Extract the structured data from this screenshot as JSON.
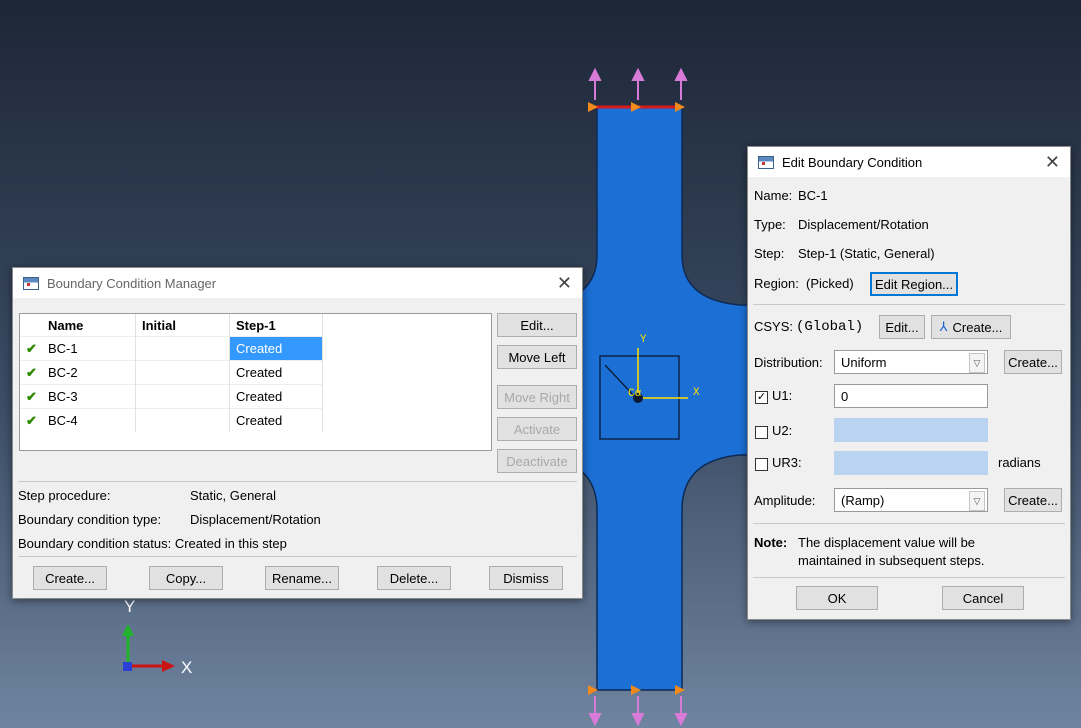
{
  "viewport": {
    "triad": {
      "y_label": "Y",
      "x_label": "X"
    },
    "csys": {
      "y_label": "Y",
      "x_label": "X"
    }
  },
  "manager": {
    "title": "Boundary Condition Manager",
    "columns": [
      "Name",
      "Initial",
      "Step-1"
    ],
    "rows": [
      {
        "name": "BC-1",
        "initial": "",
        "step1": "Created",
        "selected": true
      },
      {
        "name": "BC-2",
        "initial": "",
        "step1": "Created",
        "selected": false
      },
      {
        "name": "BC-3",
        "initial": "",
        "step1": "Created",
        "selected": false
      },
      {
        "name": "BC-4",
        "initial": "",
        "step1": "Created",
        "selected": false
      }
    ],
    "side_buttons": {
      "edit": "Edit...",
      "move_left": "Move Left",
      "move_right": "Move Right",
      "activate": "Activate",
      "deactivate": "Deactivate"
    },
    "info": {
      "procedure_label": "Step procedure:",
      "procedure_value": "Static, General",
      "type_label": "Boundary condition type:",
      "type_value": "Displacement/Rotation",
      "status_label": "Boundary condition status:",
      "status_value": "Created in this step"
    },
    "bottom_buttons": {
      "create": "Create...",
      "copy": "Copy...",
      "rename": "Rename...",
      "delete": "Delete...",
      "dismiss": "Dismiss"
    }
  },
  "edit": {
    "title": "Edit Boundary Condition",
    "name_label": "Name:",
    "name_value": "BC-1",
    "type_label": "Type:",
    "type_value": "Displacement/Rotation",
    "step_label": "Step:",
    "step_value": "Step-1 (Static, General)",
    "region_label": "Region:",
    "region_value": "(Picked)",
    "edit_region_button": "Edit Region...",
    "csys_label": "CSYS:",
    "csys_value": "(Global)",
    "csys_edit_button": "Edit...",
    "csys_create_button": "Create...",
    "distribution_label": "Distribution:",
    "distribution_value": "Uniform",
    "distribution_create_button": "Create...",
    "u1_label": "U1:",
    "u1_checked": true,
    "u1_value": "0",
    "u2_label": "U2:",
    "u2_checked": false,
    "ur3_label": "UR3:",
    "ur3_checked": false,
    "ur3_unit": "radians",
    "amplitude_label": "Amplitude:",
    "amplitude_value": "(Ramp)",
    "amplitude_create_button": "Create...",
    "note_label": "Note:",
    "note_text_1": "The displacement value will be",
    "note_text_2": "maintained in subsequent steps.",
    "ok_button": "OK",
    "cancel_button": "Cancel"
  },
  "colors": {
    "part_fill": "#1c6fd4",
    "arrow_pink": "#d87ad8",
    "arrow_orange": "#f08a1c",
    "bc_edge_red": "#d41a1a",
    "selection": "#3399ff",
    "check_green": "#2d8a00"
  }
}
